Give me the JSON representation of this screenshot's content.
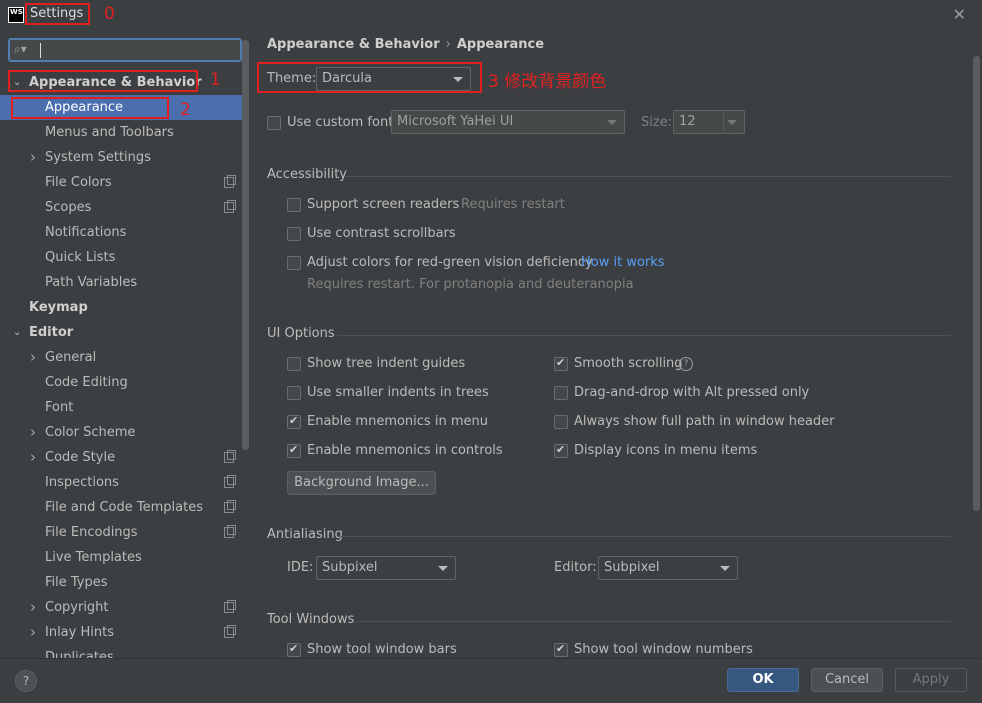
{
  "window": {
    "title": "Settings",
    "logo": "WS"
  },
  "annotations": {
    "a0": "0",
    "a1": "1",
    "a2": "2",
    "a3": "3 修改背景颜色"
  },
  "search": {
    "placeholder": ""
  },
  "sidebar": {
    "items": [
      {
        "label": "Appearance & Behavior",
        "bold": true,
        "arrow": "down"
      },
      {
        "label": "Appearance",
        "selected": true
      },
      {
        "label": "Menus and Toolbars"
      },
      {
        "label": "System Settings",
        "arrow": "right"
      },
      {
        "label": "File Colors",
        "project": true
      },
      {
        "label": "Scopes",
        "project": true
      },
      {
        "label": "Notifications"
      },
      {
        "label": "Quick Lists"
      },
      {
        "label": "Path Variables"
      },
      {
        "label": "Keymap",
        "bold": true
      },
      {
        "label": "Editor",
        "bold": true,
        "arrow": "down"
      },
      {
        "label": "General",
        "arrow": "right"
      },
      {
        "label": "Code Editing"
      },
      {
        "label": "Font"
      },
      {
        "label": "Color Scheme",
        "arrow": "right"
      },
      {
        "label": "Code Style",
        "arrow": "right",
        "project": true
      },
      {
        "label": "Inspections",
        "project": true
      },
      {
        "label": "File and Code Templates",
        "project": true
      },
      {
        "label": "File Encodings",
        "project": true
      },
      {
        "label": "Live Templates"
      },
      {
        "label": "File Types"
      },
      {
        "label": "Copyright",
        "arrow": "right",
        "project": true
      },
      {
        "label": "Inlay Hints",
        "arrow": "right",
        "project": true
      },
      {
        "label": "Duplicates"
      }
    ]
  },
  "breadcrumb": {
    "parent": "Appearance & Behavior",
    "sep": "›",
    "current": "Appearance"
  },
  "theme": {
    "label": "Theme:",
    "value": "Darcula"
  },
  "font": {
    "custom_label": "Use custom font:",
    "value": "Microsoft YaHei UI",
    "size_label": "Size:",
    "size_value": "12"
  },
  "accessibility": {
    "title": "Accessibility",
    "screen_readers": "Support screen readers",
    "requires_restart": "Requires restart",
    "contrast_scrollbars": "Use contrast scrollbars",
    "adjust_colors": "Adjust colors for red-green vision deficiency",
    "how_it_works": "How it works",
    "note": "Requires restart. For protanopia and deuteranopia"
  },
  "ui_options": {
    "title": "UI Options",
    "tree_indent": "Show tree indent guides",
    "smaller_indents": "Use smaller indents in trees",
    "mnemonics_menu": "Enable mnemonics in menu",
    "mnemonics_controls": "Enable mnemonics in controls",
    "smooth_scrolling": "Smooth scrolling",
    "drag_drop": "Drag-and-drop with Alt pressed only",
    "full_path": "Always show full path in window header",
    "display_icons": "Display icons in menu items",
    "background_image": "Background Image...",
    "help": "?"
  },
  "antialiasing": {
    "title": "Antialiasing",
    "ide_label": "IDE:",
    "ide_value": "Subpixel",
    "editor_label": "Editor:",
    "editor_value": "Subpixel"
  },
  "tool_windows": {
    "title": "Tool Windows",
    "bars": "Show tool window bars",
    "numbers": "Show tool window numbers"
  },
  "footer": {
    "help": "?",
    "ok": "OK",
    "cancel": "Cancel",
    "apply": "Apply"
  },
  "colors": {
    "accent": "#4b6eaf",
    "annotation": "#e02020",
    "link": "#589df6"
  }
}
